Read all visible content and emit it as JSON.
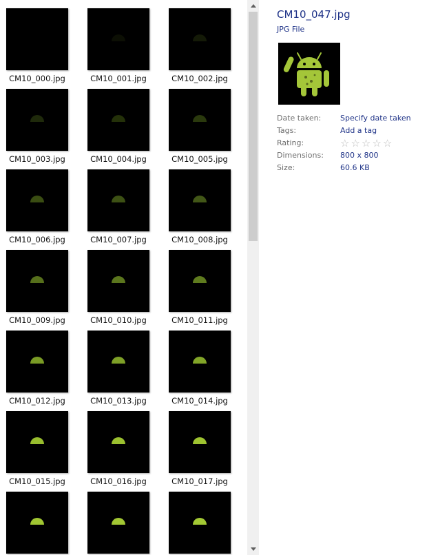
{
  "files": [
    {
      "name": "CM10_000.jpg",
      "dome_color": "#000000"
    },
    {
      "name": "CM10_001.jpg",
      "dome_color": "#0c0f04"
    },
    {
      "name": "CM10_002.jpg",
      "dome_color": "#141a07"
    },
    {
      "name": "CM10_003.jpg",
      "dome_color": "#1f2a0b"
    },
    {
      "name": "CM10_004.jpg",
      "dome_color": "#243109"
    },
    {
      "name": "CM10_005.jpg",
      "dome_color": "#2a390d"
    },
    {
      "name": "CM10_006.jpg",
      "dome_color": "#3a4d12"
    },
    {
      "name": "CM10_007.jpg",
      "dome_color": "#3d5114"
    },
    {
      "name": "CM10_008.jpg",
      "dome_color": "#425717"
    },
    {
      "name": "CM10_009.jpg",
      "dome_color": "#566f1b"
    },
    {
      "name": "CM10_010.jpg",
      "dome_color": "#5b761d"
    },
    {
      "name": "CM10_011.jpg",
      "dome_color": "#5f7b1e"
    },
    {
      "name": "CM10_012.jpg",
      "dome_color": "#7a9b25"
    },
    {
      "name": "CM10_013.jpg",
      "dome_color": "#7ea027"
    },
    {
      "name": "CM10_014.jpg",
      "dome_color": "#82a528"
    },
    {
      "name": "CM10_015.jpg",
      "dome_color": "#98bd2e"
    },
    {
      "name": "CM10_016.jpg",
      "dome_color": "#9bc02f"
    },
    {
      "name": "CM10_017.jpg",
      "dome_color": "#9ec330"
    },
    {
      "name": "",
      "dome_color": "#a0c632"
    },
    {
      "name": "",
      "dome_color": "#a2c733"
    },
    {
      "name": "",
      "dome_color": "#a3c934"
    }
  ],
  "details": {
    "filename": "CM10_047.jpg",
    "filetype": "JPG File",
    "date_taken_label": "Date taken:",
    "date_taken_value": "Specify date taken",
    "tags_label": "Tags:",
    "tags_value": "Add a tag",
    "rating_label": "Rating:",
    "rating_value": 0,
    "rating_max": 5,
    "dimensions_label": "Dimensions:",
    "dimensions_value": "800 x 800",
    "size_label": "Size:",
    "size_value": "60.6 KB"
  },
  "colors": {
    "android_green": "#a4c639",
    "link_blue": "#1e3287"
  },
  "icons": {
    "scroll_up": "chevron-up-icon",
    "scroll_down": "chevron-down-icon",
    "rating_star": "star-outline-icon",
    "preview": "android-robot-icon"
  }
}
